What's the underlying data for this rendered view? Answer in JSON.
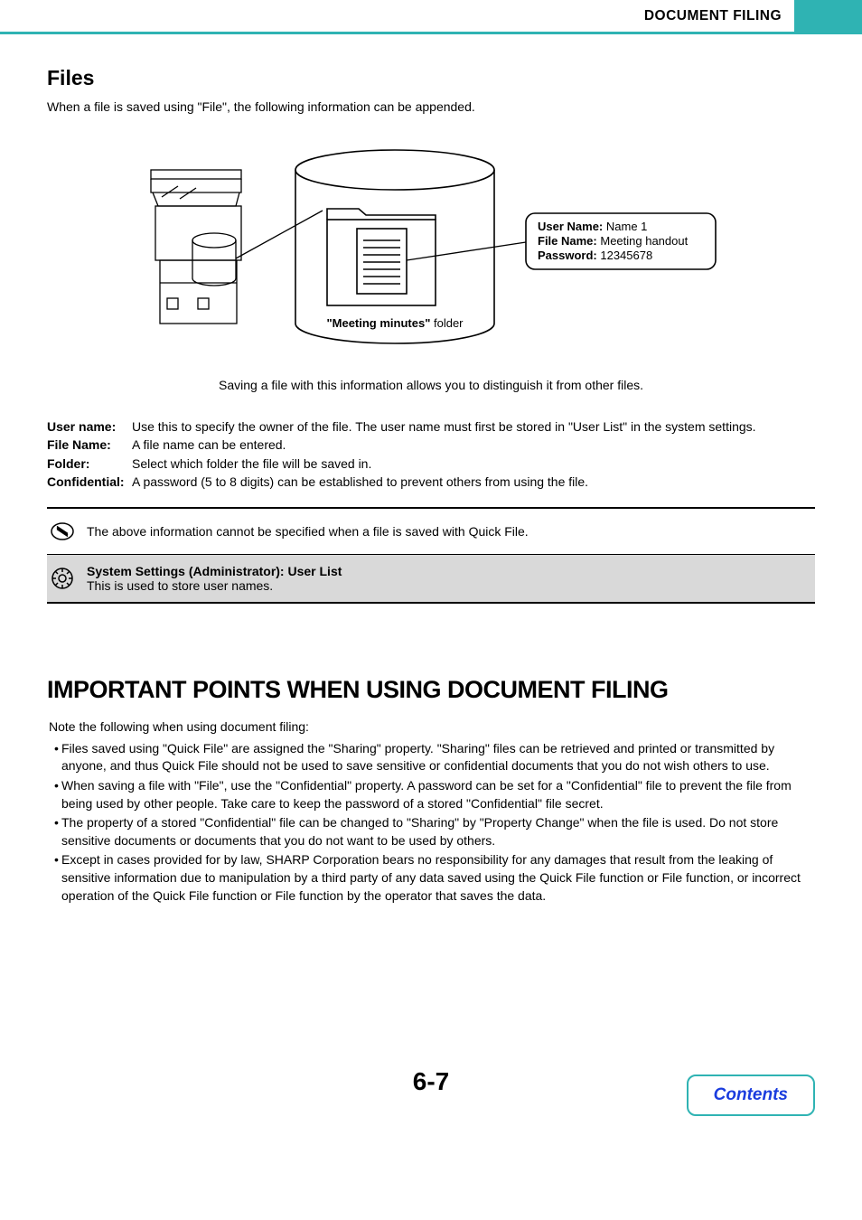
{
  "header": {
    "title": "DOCUMENT FILING"
  },
  "files": {
    "heading": "Files",
    "intro": "When a file is saved using \"File\", the following information can be appended.",
    "caption": "Saving a file with this information allows you to distinguish it from other files.",
    "callout": {
      "user_name_label": "User Name:",
      "user_name_value": "Name 1",
      "file_name_label": "File Name:",
      "file_name_value": "Meeting handout",
      "password_label": "Password:",
      "password_value": "12345678"
    },
    "folder_label_prefix": "\"Meeting minutes\"",
    "folder_label_suffix": " folder",
    "defs": [
      {
        "label": "User name:",
        "desc": "Use this to specify the owner of the file. The user name must first be stored in \"User List\" in the system settings."
      },
      {
        "label": "File Name:",
        "desc": "A file name can be entered."
      },
      {
        "label": "Folder:",
        "desc": "Select which folder the file will be saved in."
      },
      {
        "label": "Confidential:",
        "desc": "A password (5 to 8 digits) can be established to prevent others from using the file."
      }
    ],
    "note": "The above information cannot be specified when a file is saved with Quick File.",
    "admin_title": "System Settings (Administrator): User List",
    "admin_desc": "This is used to store user names."
  },
  "important": {
    "heading": "IMPORTANT POINTS WHEN USING DOCUMENT FILING",
    "intro": "Note the following when using document filing:",
    "bullets": [
      "Files saved using \"Quick File\" are assigned the \"Sharing\" property. \"Sharing\" files can be retrieved and printed or transmitted by anyone, and thus Quick File should not be used to save sensitive or confidential documents that you do not wish others to use.",
      "When saving a file with \"File\", use the \"Confidential\" property. A password can be set for a \"Confidential\" file to prevent the file from being used by other people. Take care to keep the password of a stored \"Confidential\" file secret.",
      "The property of a stored \"Confidential\" file can be changed to \"Sharing\" by \"Property Change\" when the file is used. Do not store sensitive documents or documents that you do not want to be used by others.",
      "Except in cases provided for by law, SHARP Corporation bears no responsibility for any damages that result from the leaking of sensitive information due to manipulation by a third party of any data saved using the Quick File function or File function, or incorrect operation of the Quick File function or File function by the operator that saves the data."
    ]
  },
  "footer": {
    "page_num": "6-7",
    "contents": "Contents"
  }
}
